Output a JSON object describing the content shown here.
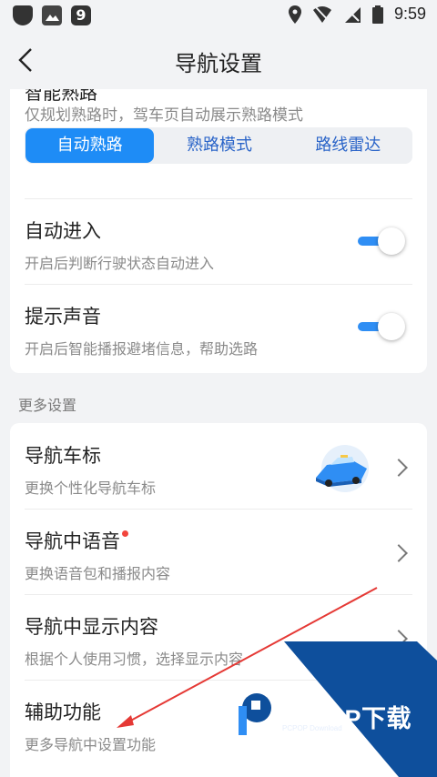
{
  "status_bar": {
    "time": "9:59"
  },
  "header": {
    "title": "导航设置"
  },
  "route_mode": {
    "cut_title": "智能熟路",
    "description": "仅规划熟路时，驾车页自动展示熟路模式",
    "options": [
      "自动熟路",
      "熟路模式",
      "路线雷达"
    ],
    "selected": "自动熟路"
  },
  "auto_enter": {
    "title": "自动进入",
    "subtitle": "开启后判断行驶状态自动进入",
    "enabled": true
  },
  "prompt_sound": {
    "title": "提示声音",
    "subtitle": "开启后智能播报避堵信息，帮助选路",
    "enabled": true
  },
  "more_settings": {
    "label": "更多设置",
    "items": [
      {
        "title": "导航车标",
        "subtitle": "更换个性化导航车标"
      },
      {
        "title": "导航中语音",
        "subtitle": "更换语音包和播报内容"
      },
      {
        "title": "导航中显示内容",
        "subtitle": "根据个人使用习惯，选择显示内容"
      },
      {
        "title": "辅助功能",
        "subtitle": "更多导航中设置功能"
      }
    ]
  },
  "watermark": {
    "text": "PCPOP下载",
    "sub": "PCPOP Download"
  },
  "colors": {
    "accent": "#1e8cf6",
    "toggle_on": "#2f8ef4",
    "badge": "#f2453d",
    "watermark_blue": "#0e4f9c",
    "arrow": "#e53935"
  }
}
